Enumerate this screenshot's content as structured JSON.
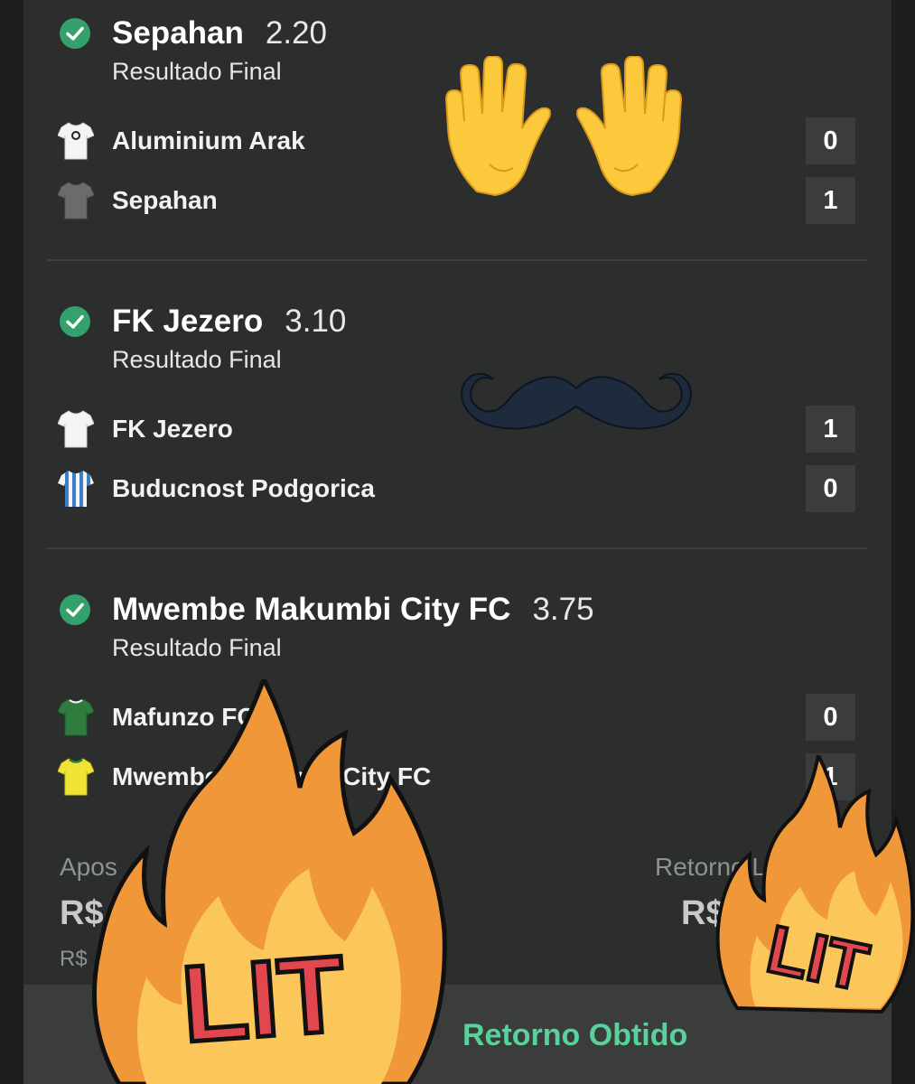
{
  "selections": [
    {
      "team": "Sepahan",
      "odds": "2.20",
      "market": "Resultado Final",
      "home": {
        "name": "Aluminium Arak",
        "score": "0",
        "jersey": "white-black-jersey-icon"
      },
      "away": {
        "name": "Sepahan",
        "score": "1",
        "jersey": "grey-jersey-icon"
      }
    },
    {
      "team": "FK Jezero",
      "odds": "3.10",
      "market": "Resultado Final",
      "home": {
        "name": "FK Jezero",
        "score": "1",
        "jersey": "white-jersey-icon"
      },
      "away": {
        "name": "Buducnost Podgorica",
        "score": "0",
        "jersey": "blue-white-striped-jersey-icon"
      }
    },
    {
      "team": "Mwembe Makumbi City FC",
      "odds": "3.75",
      "market": "Resultado Final",
      "home": {
        "name": "Mafunzo FC",
        "score": "0",
        "jersey": "green-jersey-icon"
      },
      "away": {
        "name": "Mwembe Makumbi City FC",
        "score": "1",
        "jersey": "yellow-green-jersey-icon"
      }
    }
  ],
  "footer": {
    "stake_label": "Apos",
    "stake_value": "R$",
    "stake_sub": "R$",
    "return_label": "Retorno Líq",
    "return_value": "R$"
  },
  "bottom_bar": {
    "label": "Retorno Obtido"
  },
  "stickers": {
    "lit_text": "LIT",
    "hands": "raising-hands-emoji",
    "mustache": "mustache-sticker",
    "fire": "fire-lit-sticker"
  },
  "colors": {
    "accent_green": "#58d19a",
    "check_green": "#34a06b",
    "card_bg": "#2c2e2e",
    "score_bg": "#3b3d3d"
  }
}
